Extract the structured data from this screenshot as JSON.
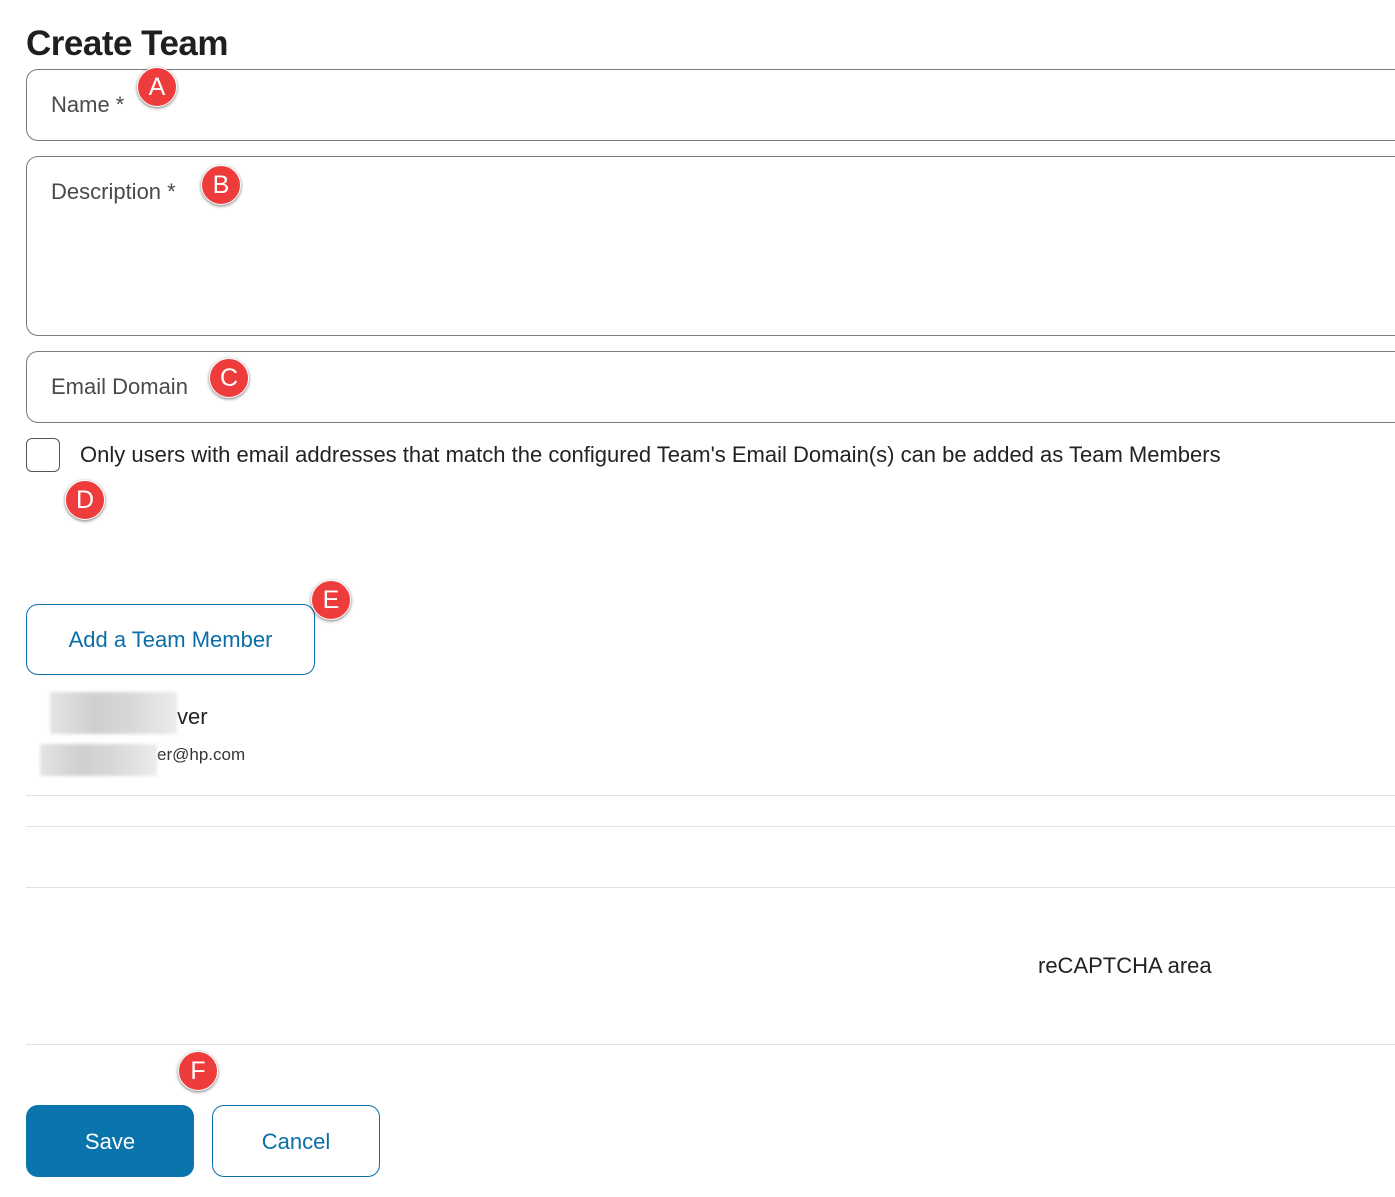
{
  "form": {
    "title": "Create Team",
    "name_label": "Name *",
    "description_label": "Description *",
    "email_domain_label": "Email Domain",
    "restrict_checkbox_label": "Only users with email addresses that match the configured Team's Email Domain(s) can be added as Team Members",
    "add_member_label": "Add a Team Member"
  },
  "member": {
    "name_visible": "ver",
    "email_visible": "er@hp.com"
  },
  "captcha": {
    "label": "reCAPTCHA area"
  },
  "actions": {
    "save_label": "Save",
    "cancel_label": "Cancel"
  },
  "markers": {
    "a": "A",
    "b": "B",
    "c": "C",
    "d": "D",
    "e": "E",
    "f": "F"
  },
  "colors": {
    "accent": "#0a74ad",
    "marker": "#ee3b3b",
    "field_border": "#7a7a7a"
  }
}
